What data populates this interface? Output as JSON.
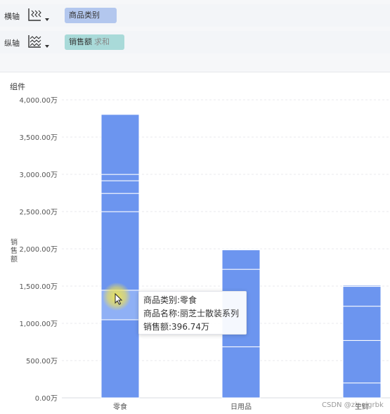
{
  "axes": {
    "x": {
      "label": "横轴",
      "icon": "horizontal-axis-icon",
      "field": "商品类别",
      "aggregation": ""
    },
    "y": {
      "label": "纵轴",
      "icon": "vertical-axis-icon",
      "field": "销售额",
      "aggregation": "求和"
    }
  },
  "panel": {
    "title": "组件"
  },
  "chart_data": {
    "type": "bar",
    "stacked": true,
    "xlabel": "",
    "ylabel": "销售额",
    "ylim": [
      0,
      4000
    ],
    "y_unit": "万",
    "y_ticks": [
      "0.00万",
      "500.00万",
      "1,000.00万",
      "1,500.00万",
      "2,000.00万",
      "2,500.00万",
      "3,000.00万",
      "3,500.00万",
      "4,000.00万"
    ],
    "categories": [
      "零食",
      "日用品",
      "生鲜"
    ],
    "bar_color": "#6c95ef",
    "highlight_color": "#8fb0f5",
    "stacks": [
      {
        "category": "零食",
        "segments": [
          1048,
          396.74,
          1054,
          245,
          170,
          85,
          805
        ],
        "total": 3804
      },
      {
        "category": "日用品",
        "segments": [
          685,
          1040,
          262,
          10
        ],
        "total": 1997
      },
      {
        "category": "生鲜",
        "segments": [
          200,
          570,
          460,
          265,
          15
        ],
        "total": 1510
      }
    ],
    "grid": true,
    "legend": "none"
  },
  "tooltip": {
    "line1": "商品类别:零食",
    "line2": "商品名称:丽芝士散装系列",
    "line3": "销售额:396.74万"
  },
  "watermark": "CSDN @zipuigrbk"
}
